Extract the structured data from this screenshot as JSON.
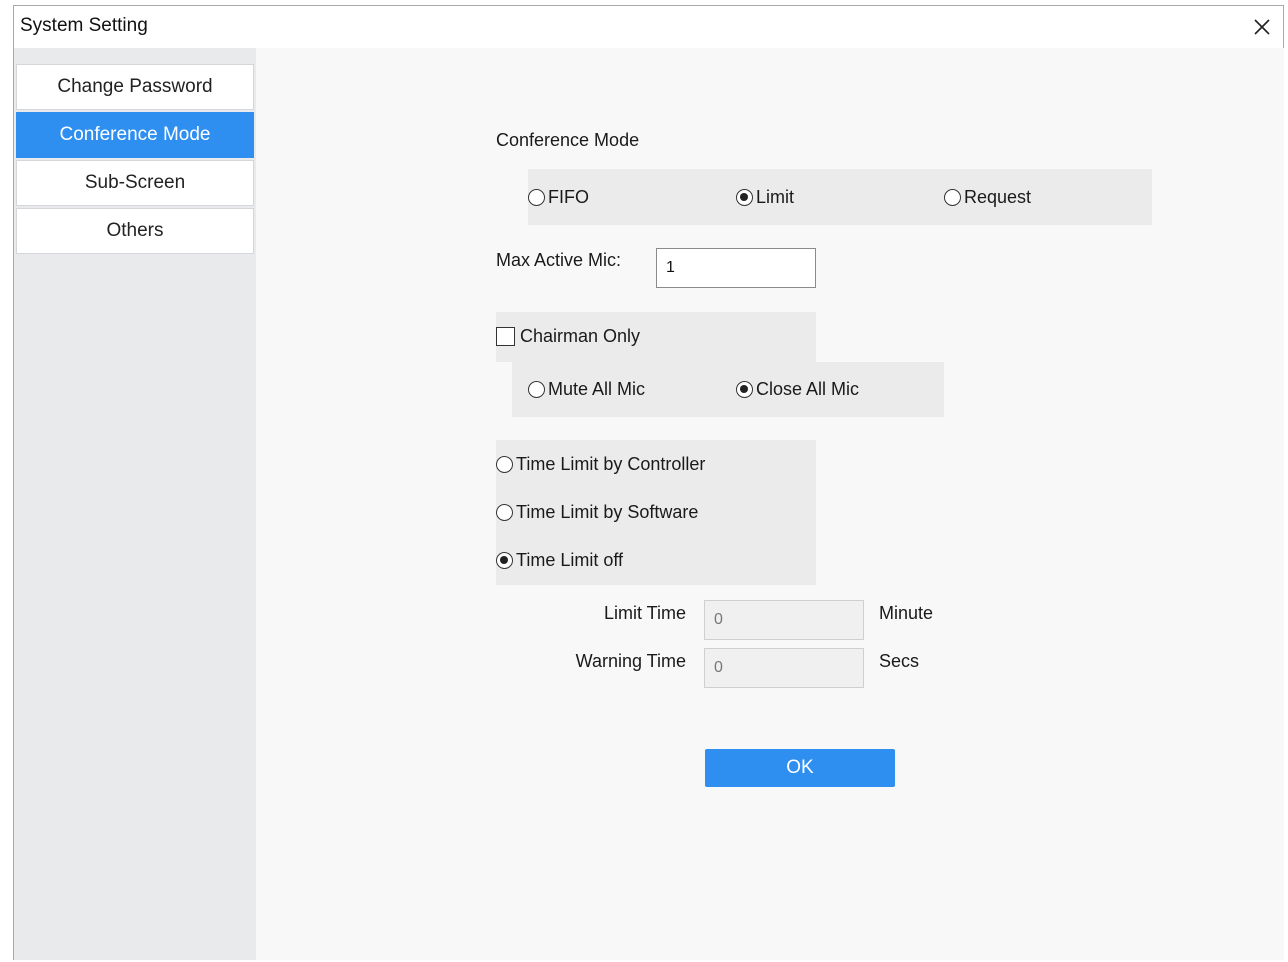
{
  "window": {
    "title": "System Setting"
  },
  "sidebar": {
    "items": [
      {
        "label": "Change Password",
        "active": false
      },
      {
        "label": "Conference Mode",
        "active": true
      },
      {
        "label": "Sub-Screen",
        "active": false
      },
      {
        "label": "Others",
        "active": false
      }
    ]
  },
  "conference_mode": {
    "heading": "Conference Mode",
    "options": [
      {
        "label": "FIFO",
        "selected": false
      },
      {
        "label": "Limit",
        "selected": true
      },
      {
        "label": "Request",
        "selected": false
      }
    ]
  },
  "max_active_mic": {
    "label": "Max Active Mic:",
    "value": "1"
  },
  "chairman_only": {
    "label": "Chairman Only",
    "checked": false
  },
  "mic_mode": {
    "options": [
      {
        "label": "Mute All Mic",
        "selected": false
      },
      {
        "label": "Close All Mic",
        "selected": true
      }
    ]
  },
  "time_limit": {
    "options": [
      {
        "label": "Time Limit by Controller",
        "selected": false
      },
      {
        "label": "Time Limit by Software",
        "selected": false
      },
      {
        "label": "Time Limit off",
        "selected": true
      }
    ],
    "limit_time": {
      "label": "Limit Time",
      "value": "0",
      "unit": "Minute"
    },
    "warning_time": {
      "label": "Warning Time",
      "value": "0",
      "unit": "Secs"
    }
  },
  "buttons": {
    "ok": "OK"
  },
  "colors": {
    "accent": "#2e8ff0",
    "sidebar_bg": "#e9eaec",
    "panel_bg": "#ebebeb"
  }
}
